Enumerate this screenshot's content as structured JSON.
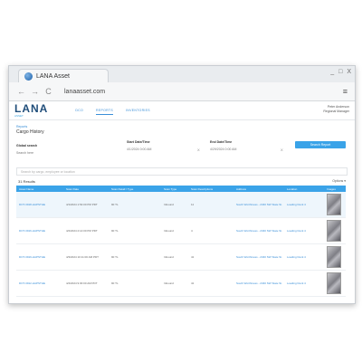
{
  "browser": {
    "tab_title": "LANA Asset",
    "url": "lanaasset.com",
    "back_icon": "←",
    "forward_icon": "→",
    "reload_icon": "C",
    "menu_icon": "≡",
    "window_controls": [
      "_",
      "□",
      "X"
    ]
  },
  "app": {
    "logo": "LANA",
    "logo_sub": "ASSET",
    "nav": [
      "DCO",
      "REPORTS",
      "INVENTORIES"
    ],
    "user_line1": "Peter Anderson",
    "user_line2": "Regional Manager"
  },
  "page": {
    "breadcrumb": "Reports",
    "title": "Cargo History"
  },
  "filters": {
    "f1_label": "Global search",
    "f1_value": "Search here",
    "f2_label": "Start Date/Time",
    "f2_value": "4/1/2024 0:00 AM",
    "f3_label": "End Date/Time",
    "f3_value": "4/29/2024 0:00 AM",
    "clear": "X",
    "search_button": "Search Report",
    "search_placeholder": "Search by cargo, employee or location"
  },
  "results": {
    "count": "31 Results",
    "options": "Options ▾"
  },
  "table": {
    "headers": [
      "Asset Name",
      "Scan Date",
      "Scan Detail / Type",
      "Scan Type",
      "Scan Descriptions",
      "Address",
      "Location",
      "Images"
    ],
    "rows": [
      [
        "DOT-3918-HAPSTHE",
        "4/1/2024 1:54:00 PM PDT",
        "90 TL",
        "Inbound",
        "11",
        "South Worthiness - 2340 SW State St.",
        "Loading Dock 4",
        ""
      ],
      [
        "DOT-3916-HAPSTHE",
        "4/2/2024 2:14:00 PM PDT",
        "90 TL",
        "Inbound",
        "4",
        "South Worthiness - 2340 SW State St.",
        "Loading Dock 4",
        ""
      ],
      [
        "DOT-3919-HAPSTHE",
        "4/3/2024 10:11:00 AM PDT",
        "90 TL",
        "Inbound",
        "41",
        "South Worthiness - 2340 SW State St.",
        "Loading Dock 4",
        ""
      ],
      [
        "DOT-3912-HAPSTHE",
        "4/4/2024 9:30:00 AM PDT",
        "90 TL",
        "Inbound",
        "41",
        "South Worthiness - 2340 SW State St.",
        "Loading Dock 4",
        ""
      ]
    ]
  }
}
